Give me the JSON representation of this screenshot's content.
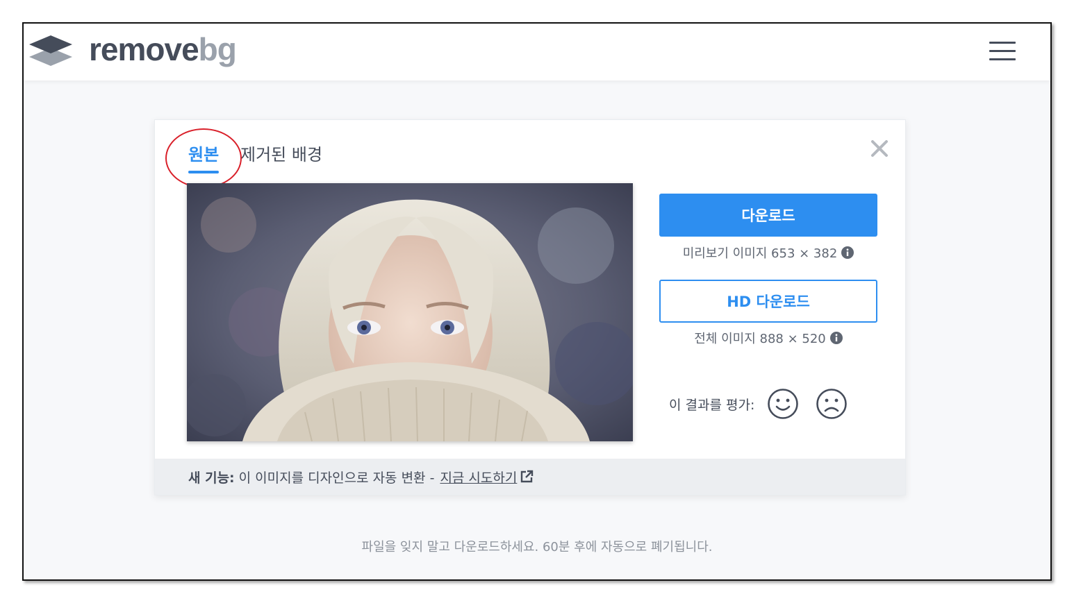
{
  "header": {
    "logo": {
      "part1": "remove",
      "part2": "bg"
    }
  },
  "card": {
    "tabs": {
      "original": "원본",
      "removed": "제거된 배경"
    },
    "download": {
      "label": "다운로드",
      "info": "미리보기 이미지 653 × 382"
    },
    "hd_download": {
      "label": "HD 다운로드",
      "info": "전체 이미지 888 × 520"
    },
    "rating": {
      "label": "이 결과를 평가:"
    },
    "feature": {
      "strong": "새 기능:",
      "text": "이 이미지를 디자인으로 자동 변환 -",
      "link": "지금 시도하기"
    }
  },
  "footer": {
    "note": "파일을 잊지 말고 다운로드하세요. 60분 후에 자동으로 폐기됩니다."
  },
  "colors": {
    "accent": "#2d8ef0",
    "text": "#454c5a",
    "annotation": "#d9202a"
  }
}
